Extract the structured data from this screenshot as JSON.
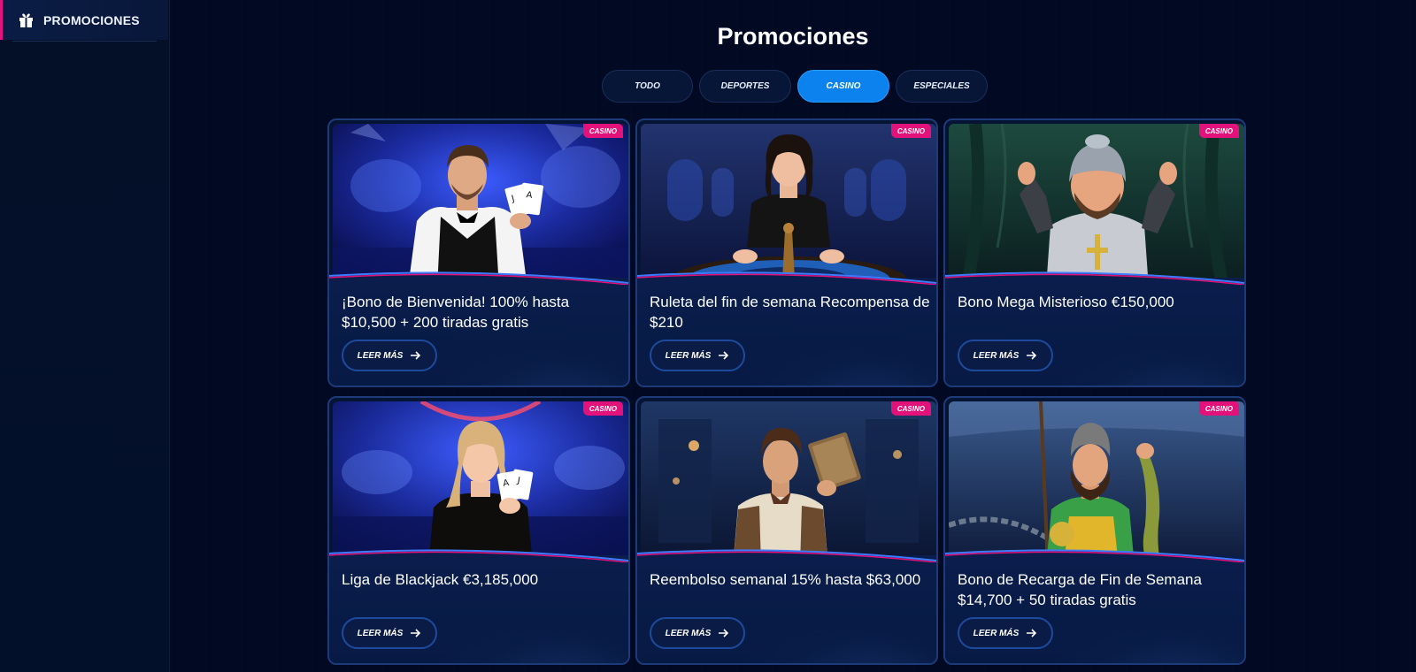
{
  "sidebar": {
    "items": [
      {
        "label": "PROMOCIONES",
        "icon": "gift-icon"
      }
    ]
  },
  "main": {
    "title": "Promociones",
    "tabs": [
      {
        "label": "TODO",
        "active": false
      },
      {
        "label": "DEPORTES",
        "active": false
      },
      {
        "label": "CASINO",
        "active": true
      },
      {
        "label": "ESPECIALES",
        "active": false
      }
    ],
    "cards": [
      {
        "badge": "CASINO",
        "title": "¡Bono de Bienvenida! 100% hasta $10,500 + 200 tiradas gratis",
        "button": "LEER MÁS",
        "image": "male-dealer-holding-cards"
      },
      {
        "badge": "CASINO",
        "title": "Ruleta del fin de semana Recompensa de $210",
        "button": "LEER MÁS",
        "image": "female-dealer-at-roulette"
      },
      {
        "badge": "CASINO",
        "title": "Bono Mega Misterioso €150,000",
        "button": "LEER MÁS",
        "image": "armored-knight-thumbs-up"
      },
      {
        "badge": "CASINO",
        "title": "Liga de Blackjack €3,185,000",
        "button": "LEER MÁS",
        "image": "female-dealer-holding-cards"
      },
      {
        "badge": "CASINO",
        "title": "Reembolso semanal 15% hasta $63,000",
        "button": "LEER MÁS",
        "image": "explorer-holding-book"
      },
      {
        "badge": "CASINO",
        "title": "Bono de Recarga de Fin de Semana $14,700 + 50 tiradas gratis",
        "button": "LEER MÁS",
        "image": "fisherman-holding-fish"
      }
    ]
  },
  "colors": {
    "accent": "#0b82ee",
    "badge": "#e2127a",
    "background": "#010a22"
  }
}
